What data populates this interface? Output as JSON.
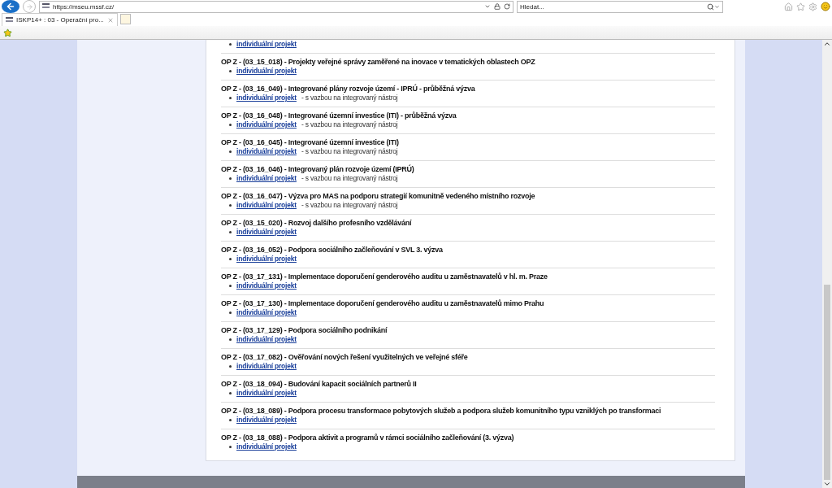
{
  "browser": {
    "url": "https://mseu.mssf.cz/",
    "search_placeholder": "Hledat...",
    "tabs": [
      {
        "title": "ISKP14+ : 03 - Operační pro...",
        "selected": true
      }
    ]
  },
  "calls": [
    {
      "link": "individuální projekt"
    },
    {
      "title": "OP Z - (03_15_018) - Projekty veřejné správy zaměřené na inovace v tematických oblastech OPZ",
      "link": "individuální projekt"
    },
    {
      "title": "OP Z - (03_16_049) - Integrované plány rozvoje území - IPRÚ - průběžná výzva",
      "link": "individuální projekt",
      "note": "- s vazbou na integrovaný nástroj"
    },
    {
      "title": "OP Z - (03_16_048) - Integrované územní investice (ITI) - průběžná výzva",
      "link": "individuální projekt",
      "note": "- s vazbou na integrovaný nástroj"
    },
    {
      "title": "OP Z - (03_16_045) - Integrované územní investice (ITI)",
      "link": "individuální projekt",
      "note": "- s vazbou na integrovaný nástroj"
    },
    {
      "title": "OP Z - (03_16_046) - Integrovaný plán rozvoje území (IPRÚ)",
      "link": "individuální projekt",
      "note": "- s vazbou na integrovaný nástroj"
    },
    {
      "title": "OP Z - (03_16_047) - Výzva pro MAS na podporu strategií komunitně vedeného místního rozvoje",
      "link": "individuální projekt",
      "note": "- s vazbou na integrovaný nástroj"
    },
    {
      "title": "OP Z - (03_15_020) - Rozvoj dalšího profesního vzdělávání",
      "link": "individuální projekt"
    },
    {
      "title": "OP Z - (03_16_052) - Podpora sociálního začleňování v SVL 3. výzva",
      "link": "individuální projekt"
    },
    {
      "title": "OP Z - (03_17_131) - Implementace doporučení genderového auditu u zaměstnavatelů v hl. m. Praze",
      "link": "individuální projekt"
    },
    {
      "title": "OP Z - (03_17_130) - Implementace doporučení genderového auditu u zaměstnavatelů mimo Prahu",
      "link": "individuální projekt"
    },
    {
      "title": "OP Z - (03_17_129) - Podpora sociálního podnikání",
      "link": "individuální projekt"
    },
    {
      "title": "OP Z - (03_17_082) - Ověřování nových řešení využitelných ve veřejné sféře",
      "link": "individuální projekt"
    },
    {
      "title": "OP Z - (03_18_094) - Budování kapacit sociálních partnerů II",
      "link": "individuální projekt"
    },
    {
      "title": "OP Z - (03_18_089) - Podpora procesu transformace pobytových služeb a podpora služeb komunitního typu vzniklých po transformaci",
      "link": "individuální projekt"
    },
    {
      "title": "OP Z - (03_18_088) - Podpora aktivit a programů v rámci sociálního začleňování (3. výzva)",
      "link": "individuální projekt"
    }
  ]
}
